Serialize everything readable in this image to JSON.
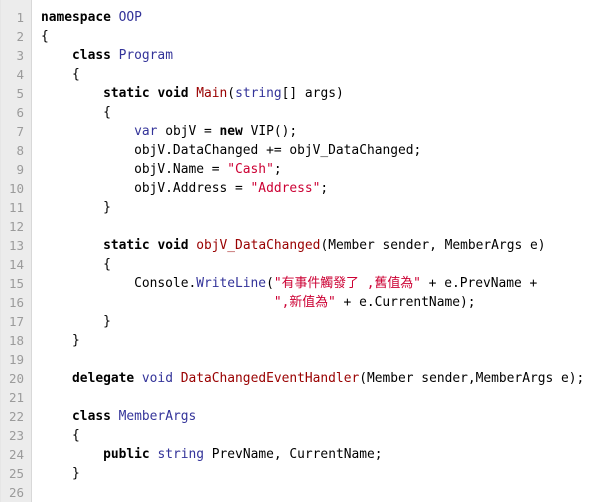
{
  "editor": {
    "line_numbers": [
      "1",
      "2",
      "3",
      "4",
      "5",
      "6",
      "7",
      "8",
      "9",
      "10",
      "11",
      "12",
      "13",
      "14",
      "15",
      "16",
      "17",
      "18",
      "19",
      "20",
      "21",
      "22",
      "23",
      "24",
      "25",
      "26"
    ],
    "lines": [
      [
        {
          "t": "namespace",
          "k": "kw"
        },
        {
          "t": " OOP",
          "k": "type"
        }
      ],
      [
        {
          "t": "{",
          "k": "plain"
        }
      ],
      [
        {
          "t": "    ",
          "k": "plain"
        },
        {
          "t": "class",
          "k": "kw"
        },
        {
          "t": " ",
          "k": "plain"
        },
        {
          "t": "Program",
          "k": "type"
        }
      ],
      [
        {
          "t": "    {",
          "k": "plain"
        }
      ],
      [
        {
          "t": "        ",
          "k": "plain"
        },
        {
          "t": "static",
          "k": "kw"
        },
        {
          "t": " ",
          "k": "plain"
        },
        {
          "t": "void",
          "k": "kw"
        },
        {
          "t": " ",
          "k": "plain"
        },
        {
          "t": "Main",
          "k": "method"
        },
        {
          "t": "(",
          "k": "plain"
        },
        {
          "t": "string",
          "k": "type"
        },
        {
          "t": "[] args)",
          "k": "plain"
        }
      ],
      [
        {
          "t": "        {",
          "k": "plain"
        }
      ],
      [
        {
          "t": "            ",
          "k": "plain"
        },
        {
          "t": "var",
          "k": "type"
        },
        {
          "t": " objV = ",
          "k": "plain"
        },
        {
          "t": "new",
          "k": "kw"
        },
        {
          "t": " VIP();",
          "k": "plain"
        }
      ],
      [
        {
          "t": "            objV.DataChanged += objV_DataChanged;",
          "k": "plain"
        }
      ],
      [
        {
          "t": "            objV.Name = ",
          "k": "plain"
        },
        {
          "t": "\"Cash\"",
          "k": "str"
        },
        {
          "t": ";",
          "k": "plain"
        }
      ],
      [
        {
          "t": "            objV.Address = ",
          "k": "plain"
        },
        {
          "t": "\"Address\"",
          "k": "str"
        },
        {
          "t": ";",
          "k": "plain"
        }
      ],
      [
        {
          "t": "        }",
          "k": "plain"
        }
      ],
      [],
      [
        {
          "t": "        ",
          "k": "plain"
        },
        {
          "t": "static",
          "k": "kw"
        },
        {
          "t": " ",
          "k": "plain"
        },
        {
          "t": "void",
          "k": "kw"
        },
        {
          "t": " ",
          "k": "plain"
        },
        {
          "t": "objV_DataChanged",
          "k": "method"
        },
        {
          "t": "(Member sender, MemberArgs e)",
          "k": "plain"
        }
      ],
      [
        {
          "t": "        {",
          "k": "plain"
        }
      ],
      [
        {
          "t": "            Console.",
          "k": "plain"
        },
        {
          "t": "WriteLine",
          "k": "type"
        },
        {
          "t": "(",
          "k": "plain"
        },
        {
          "t": "\"有事件觸發了 ,舊值為\"",
          "k": "str"
        },
        {
          "t": " + e.PrevName +",
          "k": "plain"
        }
      ],
      [
        {
          "t": "                              ",
          "k": "plain"
        },
        {
          "t": "\",新值為\"",
          "k": "str"
        },
        {
          "t": " + e.CurrentName);",
          "k": "plain"
        }
      ],
      [
        {
          "t": "        }",
          "k": "plain"
        }
      ],
      [
        {
          "t": "    }",
          "k": "plain"
        }
      ],
      [],
      [
        {
          "t": "    ",
          "k": "plain"
        },
        {
          "t": "delegate",
          "k": "kw"
        },
        {
          "t": " ",
          "k": "plain"
        },
        {
          "t": "void",
          "k": "type"
        },
        {
          "t": " ",
          "k": "plain"
        },
        {
          "t": "DataChangedEventHandler",
          "k": "method"
        },
        {
          "t": "(Member sender,MemberArgs e);",
          "k": "plain"
        }
      ],
      [],
      [
        {
          "t": "    ",
          "k": "plain"
        },
        {
          "t": "class",
          "k": "kw"
        },
        {
          "t": " ",
          "k": "plain"
        },
        {
          "t": "MemberArgs",
          "k": "type"
        }
      ],
      [
        {
          "t": "    {",
          "k": "plain"
        }
      ],
      [
        {
          "t": "        ",
          "k": "plain"
        },
        {
          "t": "public",
          "k": "kw"
        },
        {
          "t": " ",
          "k": "plain"
        },
        {
          "t": "string",
          "k": "type"
        },
        {
          "t": " PrevName, CurrentName;",
          "k": "plain"
        }
      ],
      [
        {
          "t": "    }",
          "k": "plain"
        }
      ],
      []
    ]
  }
}
